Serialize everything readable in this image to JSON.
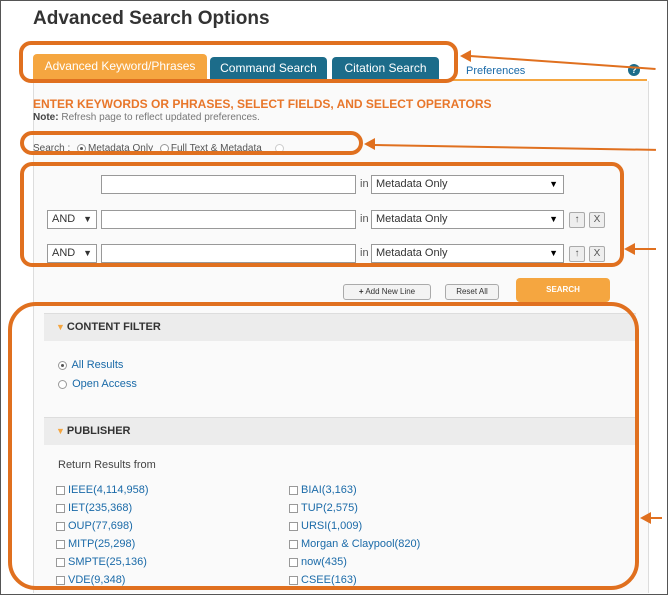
{
  "page": {
    "title": "Advanced Search Options"
  },
  "tabs": [
    {
      "label": "Advanced Keyword/Phrases",
      "active": true
    },
    {
      "label": "Command Search",
      "active": false
    },
    {
      "label": "Citation Search",
      "active": false
    }
  ],
  "preferences_label": "Preferences",
  "help_label": "?",
  "instructions": "ENTER KEYWORDS OR PHRASES, SELECT FIELDS, AND SELECT OPERATORS",
  "note": {
    "prefix": "Note:",
    "text": "Refresh page to reflect updated preferences."
  },
  "search_scope": {
    "label": "Search :",
    "options": [
      {
        "label": "Metadata Only",
        "selected": true
      },
      {
        "label": "Full Text & Metadata",
        "selected": false
      }
    ]
  },
  "query_rows": [
    {
      "operator": "",
      "value": "",
      "in_label": "in",
      "field": "Metadata Only"
    },
    {
      "operator": "AND",
      "value": "",
      "in_label": "in",
      "field": "Metadata Only"
    },
    {
      "operator": "AND",
      "value": "",
      "in_label": "in",
      "field": "Metadata Only"
    }
  ],
  "buttons": {
    "add_new_line": "Add New Line",
    "reset_all": "Reset All",
    "search": "SEARCH",
    "add_icon": "+",
    "move_up_icon": "↑",
    "remove_icon": "X"
  },
  "content_filter": {
    "title": "CONTENT FILTER",
    "options": [
      {
        "label": "All Results",
        "selected": true
      },
      {
        "label": "Open Access",
        "selected": false
      }
    ]
  },
  "publisher": {
    "title": "PUBLISHER",
    "intro": "Return Results from",
    "left": [
      "IEEE(4,114,958)",
      "IET(235,368)",
      "OUP(77,698)",
      "MITP(25,298)",
      "SMPTE(25,136)",
      "VDE(9,348)"
    ],
    "right": [
      "BIAI(3,163)",
      "TUP(2,575)",
      "URSI(1,009)",
      "Morgan & Claypool(820)",
      "now(435)",
      "CSEE(163)"
    ]
  },
  "colors": {
    "accent": "#f5a640",
    "tab_inactive": "#1c6c8a",
    "annotation": "#e0701f",
    "link": "#1a6aa8"
  }
}
